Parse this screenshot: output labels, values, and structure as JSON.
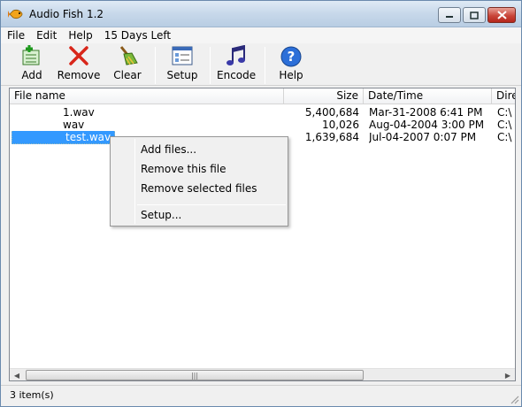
{
  "window": {
    "title": "Audio Fish 1.2"
  },
  "menu": [
    "File",
    "Edit",
    "Help",
    "15 Days Left"
  ],
  "toolbar": {
    "add": "Add",
    "remove": "Remove",
    "clear": "Clear",
    "setup": "Setup",
    "encode": "Encode",
    "help": "Help"
  },
  "list": {
    "columns": {
      "name": "File name",
      "size": "Size",
      "date": "Date/Time",
      "dir": "Dire"
    },
    "rows": [
      {
        "name": "1.wav",
        "size": "5,400,684",
        "date": "Mar-31-2008 6:41 PM",
        "dir": "C:\\"
      },
      {
        "name": "wav",
        "size": "10,026",
        "date": "Aug-04-2004 3:00 PM",
        "dir": "C:\\"
      },
      {
        "name": "test.wav",
        "size": "1,639,684",
        "date": "Jul-04-2007 0:07 PM",
        "dir": "C:\\"
      }
    ]
  },
  "scroll": {
    "thumb_grip": "|||"
  },
  "status": {
    "text": "3 item(s)"
  },
  "context_menu": {
    "add_files": "Add files...",
    "remove_file": "Remove this file",
    "remove_selected": "Remove selected files",
    "setup": "Setup..."
  }
}
